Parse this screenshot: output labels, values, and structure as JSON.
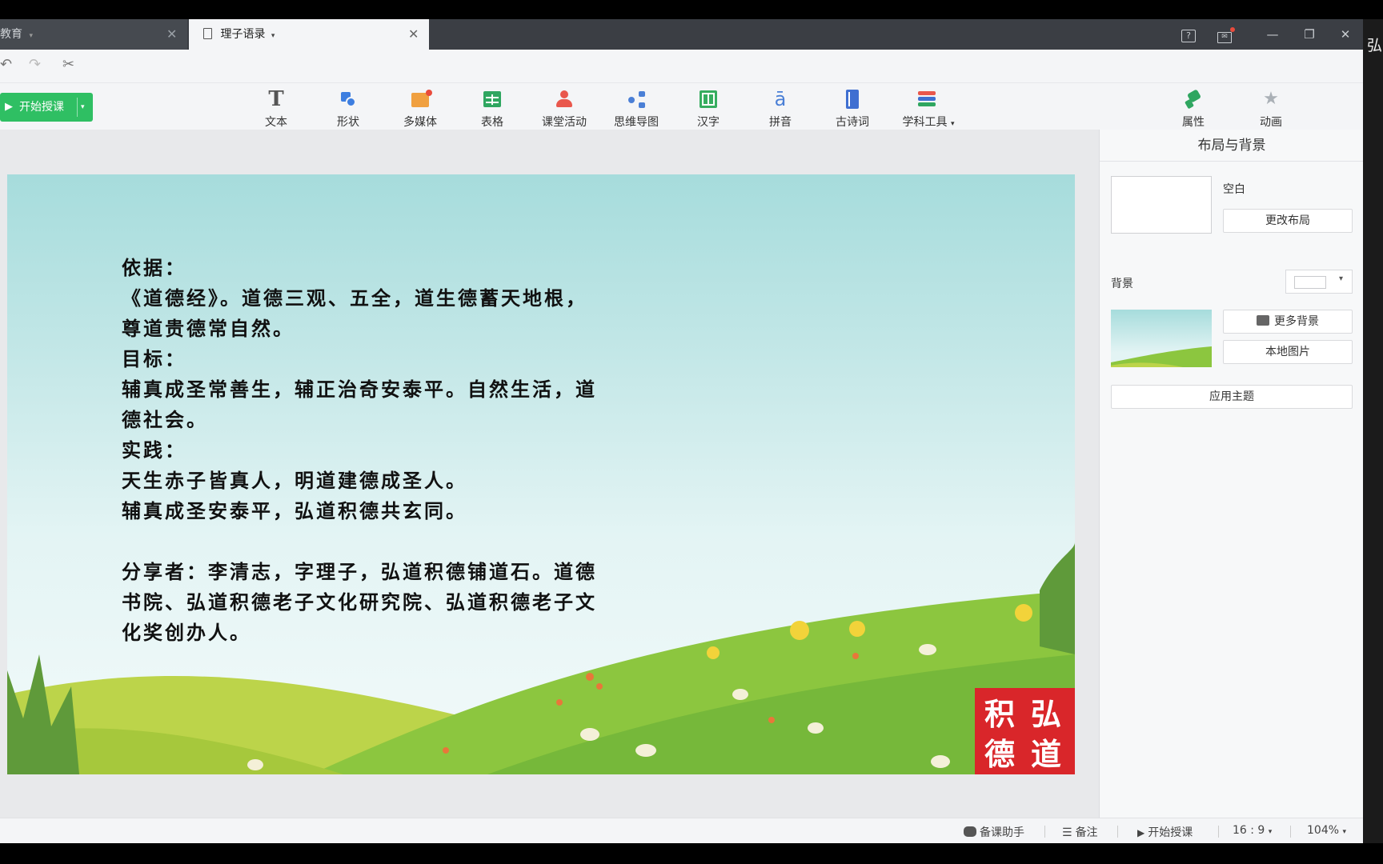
{
  "tabs": [
    {
      "label": "教育",
      "has_dropdown": true
    },
    {
      "label": "理子语录",
      "has_dropdown": true,
      "active": true
    }
  ],
  "toolbar": {
    "start_label": "开始授课",
    "tools": [
      {
        "name": "text",
        "label": "文本"
      },
      {
        "name": "shape",
        "label": "形状"
      },
      {
        "name": "media",
        "label": "多媒体"
      },
      {
        "name": "table",
        "label": "表格"
      },
      {
        "name": "activity",
        "label": "课堂活动"
      },
      {
        "name": "mindmap",
        "label": "思维导图"
      },
      {
        "name": "hanzi",
        "label": "汉字"
      },
      {
        "name": "pinyin",
        "label": "拼音"
      },
      {
        "name": "poetry",
        "label": "古诗词"
      },
      {
        "name": "subject",
        "label": "学科工具"
      }
    ],
    "right_tools": [
      {
        "name": "properties",
        "label": "属性"
      },
      {
        "name": "animation",
        "label": "动画"
      }
    ]
  },
  "slide": {
    "lines": [
      "依据：",
      "《道德经》。道德三观、五全，道生德蓄天地根，",
      "尊道贵德常自然。",
      "目标：",
      "辅真成圣常善生，辅正治奇安泰平。自然生活，道",
      "德社会。",
      "实践：",
      "天生赤子皆真人，明道建德成圣人。",
      "辅真成圣安泰平，弘道积德共玄同。",
      "",
      "分享者：李清志，字理子，弘道积德铺道石。道德",
      "书院、弘道积德老子文化研究院、弘道积德老子文",
      "化奖创办人。"
    ],
    "seal_text": [
      "弘",
      "道",
      "积",
      "德"
    ]
  },
  "panel": {
    "title": "布局与背景",
    "layout_name": "空白",
    "change_layout": "更改布局",
    "background_label": "背景",
    "more_backgrounds": "更多背景",
    "local_image": "本地图片",
    "apply_theme": "应用主题"
  },
  "statusbar": {
    "assistant": "备课助手",
    "notes": "备注",
    "start": "开始授课",
    "ratio": "16 : 9",
    "zoom": "104%"
  },
  "edge_char": "弘",
  "colors": {
    "accent_green": "#2fbf63",
    "seal_red": "#d9262a"
  }
}
